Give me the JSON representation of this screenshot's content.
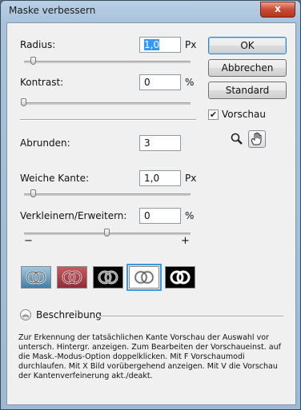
{
  "window": {
    "title": "Maske verbessern",
    "close_label": "x"
  },
  "fields": {
    "radius": {
      "label": "Radius:",
      "value": "1,0",
      "unit": "Px",
      "slider": 0.06
    },
    "kontrast": {
      "label": "Kontrast:",
      "value": "0",
      "unit": "%",
      "slider": 0.0
    },
    "abrunden": {
      "label": "Abrunden:",
      "value": "3"
    },
    "weiche_kante": {
      "label": "Weiche Kante:",
      "value": "1,0",
      "unit": "Px",
      "slider": 0.06
    },
    "verkleinern": {
      "label": "Verkleinern/Erweitern:",
      "value": "0",
      "unit": "%",
      "slider": 0.5,
      "minus": "−",
      "plus": "+"
    }
  },
  "buttons": {
    "ok": "OK",
    "abbrechen": "Abbrechen",
    "standard": "Standard"
  },
  "vorschau": {
    "label": "Vorschau",
    "checked": true
  },
  "tools": [
    "zoom-icon",
    "hand-icon"
  ],
  "preview_modes": [
    "standard-mode",
    "quick-mask-mode",
    "on-black-mode",
    "on-white-mode",
    "mask-mode"
  ],
  "selected_preview_mode": 3,
  "beschreibung": {
    "label": "Beschreibung",
    "text": "Zur Erkennung der tatsächlichen Kante Vorschau der Auswahl vor untersch. Hintergr. anzeigen. Zum Bearbeiten der Vorschaueinst. auf die Mask.-Modus-Option doppelklicken. Mit F Vorschaumodi durchlaufen. Mit X Bild vorübergehend anzeigen. Mit V die Vorschau der Kantenverfeinerung akt./deakt."
  }
}
